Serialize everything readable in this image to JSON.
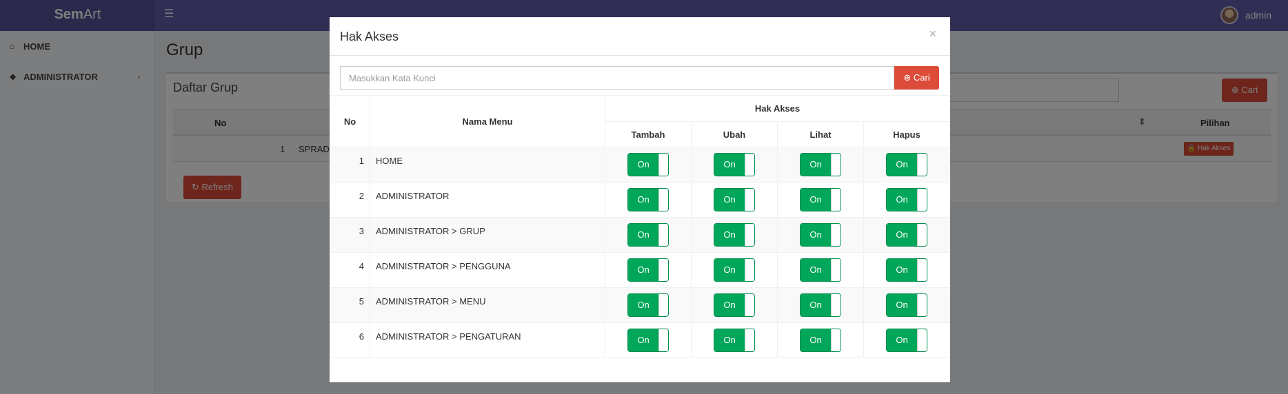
{
  "app": {
    "logo_bold": "Sem",
    "logo_regular": "Art",
    "user_name": "admin"
  },
  "sidebar": {
    "items": [
      {
        "label": "HOME",
        "icon": "home-icon"
      },
      {
        "label": "ADMINISTRATOR",
        "icon": "shield-icon",
        "chevron": "‹"
      }
    ]
  },
  "page": {
    "title": "Grup",
    "box_title": "Daftar Grup",
    "search_button": "Cari",
    "table": {
      "col_no": "No",
      "col_pilihan": "Pilihan",
      "rows": [
        {
          "no": "1",
          "name": "SPRADM",
          "action": "Hak Akses"
        }
      ]
    },
    "refresh_button": "Refresh"
  },
  "modal": {
    "title": "Hak Akses",
    "close": "×",
    "search_placeholder": "Masukkan Kata Kunci",
    "search_button": "Cari",
    "headers": {
      "no": "No",
      "menu": "Nama Menu",
      "group": "Hak Akses",
      "tambah": "Tambah",
      "ubah": "Ubah",
      "lihat": "Lihat",
      "hapus": "Hapus"
    },
    "rows": [
      {
        "no": "1",
        "menu": "HOME",
        "tambah": "On",
        "ubah": "On",
        "lihat": "On",
        "hapus": "On"
      },
      {
        "no": "2",
        "menu": "ADMINISTRATOR",
        "tambah": "On",
        "ubah": "On",
        "lihat": "On",
        "hapus": "On"
      },
      {
        "no": "3",
        "menu": "ADMINISTRATOR > GRUP",
        "tambah": "On",
        "ubah": "On",
        "lihat": "On",
        "hapus": "On"
      },
      {
        "no": "4",
        "menu": "ADMINISTRATOR > PENGGUNA",
        "tambah": "On",
        "ubah": "On",
        "lihat": "On",
        "hapus": "On"
      },
      {
        "no": "5",
        "menu": "ADMINISTRATOR > MENU",
        "tambah": "On",
        "ubah": "On",
        "lihat": "On",
        "hapus": "On"
      },
      {
        "no": "6",
        "menu": "ADMINISTRATOR > PENGATURAN",
        "tambah": "On",
        "ubah": "On",
        "lihat": "On",
        "hapus": "On"
      }
    ]
  },
  "colors": {
    "navbar": "#605ca8",
    "switch_on": "#00a65a",
    "danger": "#dd4b39"
  }
}
